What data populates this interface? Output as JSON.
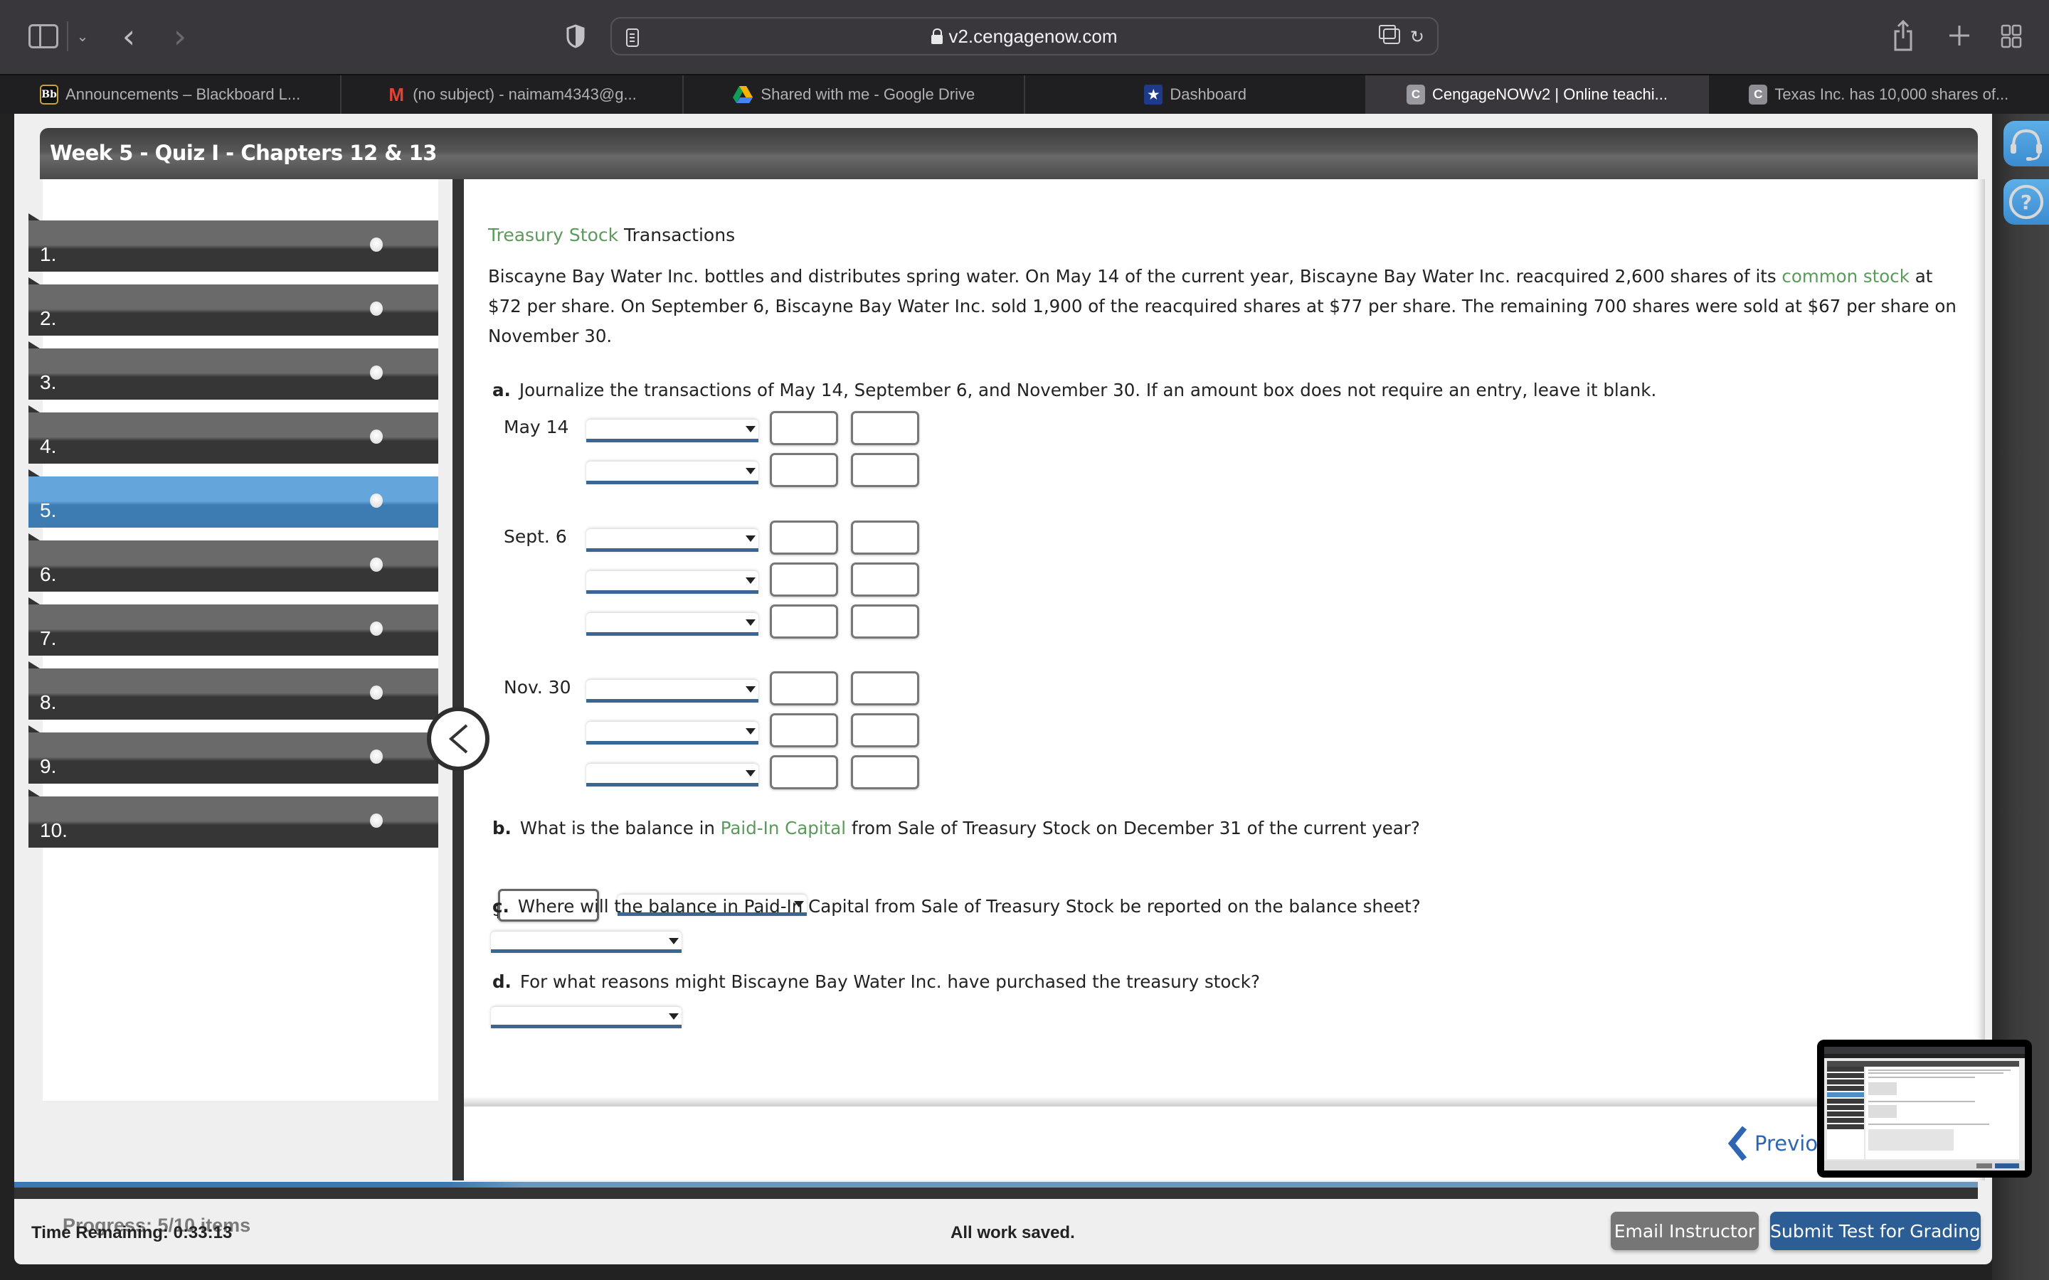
{
  "browser": {
    "url": "v2.cengagenow.com",
    "tabs": [
      {
        "label": "Announcements – Blackboard L...",
        "favicon": "Bb",
        "icon": "blackboard-icon",
        "active": false
      },
      {
        "label": "(no subject) - naimam4343@g...",
        "favicon": "M",
        "icon": "gmail-icon",
        "active": false
      },
      {
        "label": "Shared with me - Google Drive",
        "favicon": "",
        "icon": "google-drive-icon",
        "active": false
      },
      {
        "label": "Dashboard",
        "favicon": "★",
        "icon": "dashboard-star-icon",
        "active": false
      },
      {
        "label": "CengageNOWv2 | Online teachi...",
        "favicon": "C",
        "icon": "cengage-icon",
        "active": true
      },
      {
        "label": "Texas Inc. has 10,000 shares of...",
        "favicon": "C",
        "icon": "cengage-icon",
        "active": false
      }
    ]
  },
  "quiz": {
    "title": "Week 5 - Quiz I - Chapters 12 & 13",
    "questions": [
      {
        "label": "1.",
        "active": false
      },
      {
        "label": "2.",
        "active": false
      },
      {
        "label": "3.",
        "active": false
      },
      {
        "label": "4.",
        "active": false
      },
      {
        "label": "5.",
        "active": true
      },
      {
        "label": "6.",
        "active": false
      },
      {
        "label": "7.",
        "active": false
      },
      {
        "label": "8.",
        "active": false
      },
      {
        "label": "9.",
        "active": false
      },
      {
        "label": "10.",
        "active": false
      }
    ],
    "progress_label": "Progress:  5/10 items"
  },
  "problem": {
    "title_link": "Treasury Stock",
    "title_rest": " Transactions",
    "text_part1": "Biscayne Bay Water Inc. bottles and distributes spring water. On May 14 of the current year, Biscayne Bay Water Inc. reacquired 2,600 shares of its ",
    "text_link": "common stock",
    "text_part2": " at $72 per share. On September 6, Biscayne Bay Water Inc. sold 1,900 of the reacquired shares at $77 per share. The remaining 700 shares were sold at $67 per share on November 30.",
    "part_a": {
      "letter": "a.",
      "prompt": "Journalize the transactions of May 14, September 6, and November 30. If an amount box does not require an entry, leave it blank.",
      "entries": [
        {
          "date": "May 14",
          "rows": [
            {
              "account": "",
              "debit": "",
              "credit": ""
            },
            {
              "account": "",
              "debit": "",
              "credit": ""
            }
          ]
        },
        {
          "date": "Sept. 6",
          "rows": [
            {
              "account": "",
              "debit": "",
              "credit": ""
            },
            {
              "account": "",
              "debit": "",
              "credit": ""
            },
            {
              "account": "",
              "debit": "",
              "credit": ""
            }
          ]
        },
        {
          "date": "Nov. 30",
          "rows": [
            {
              "account": "",
              "debit": "",
              "credit": ""
            },
            {
              "account": "",
              "debit": "",
              "credit": ""
            },
            {
              "account": "",
              "debit": "",
              "credit": ""
            }
          ]
        }
      ]
    },
    "part_b": {
      "letter": "b.",
      "prompt_before": "What is the balance in ",
      "prompt_link": "Paid-In Capital",
      "prompt_after": " from Sale of Treasury Stock on December 31 of the current year?",
      "currency": "$",
      "amount": "",
      "balance_type": ""
    },
    "part_c": {
      "letter": "c.",
      "prompt": "Where will the balance in Paid-In Capital from Sale of Treasury Stock be reported on the balance sheet?",
      "selection": ""
    },
    "part_d": {
      "letter": "d.",
      "prompt": "For what reasons might Biscayne Bay Water Inc. have purchased the treasury stock?",
      "selection": ""
    }
  },
  "navigation": {
    "previous_label": "Previous"
  },
  "footer": {
    "time_remaining": "Time Remaining: 0:33:13",
    "save_status": "All work saved.",
    "email_instructor_label": "Email Instructor",
    "submit_label": "Submit Test for Grading"
  },
  "colors": {
    "link_green": "#5a9a5a",
    "active_question_blue": "#3d7bb3",
    "submit_blue": "#2c5d94",
    "email_gray": "#767676",
    "previous_blue": "#2e66b4"
  }
}
